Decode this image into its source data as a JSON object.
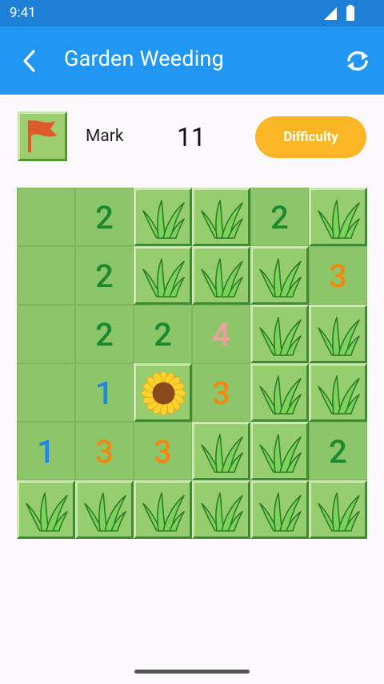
{
  "status_bar": {
    "time": "9:41",
    "icons": [
      "signal-icon",
      "battery-icon"
    ]
  },
  "app_bar": {
    "title": "Garden Weeding",
    "back_icon": "back-arrow-icon",
    "refresh_icon": "refresh-icon",
    "color": "#2196f3"
  },
  "toolbar": {
    "flag_icon": "flag-icon",
    "mode_label": "Mark",
    "mines_remaining": "11",
    "difficulty_label": "Difficulty",
    "difficulty_color": "#fbb626"
  },
  "board": {
    "rows": 6,
    "cols": 6,
    "cells": [
      [
        "r",
        "2",
        "g",
        "g",
        "2",
        "g"
      ],
      [
        "r",
        "2",
        "g",
        "g",
        "g",
        "3"
      ],
      [
        "r",
        "2",
        "2",
        "4",
        "g",
        "g"
      ],
      [
        "r",
        "1",
        "sun",
        "3",
        "g",
        "g"
      ],
      [
        "1",
        "3",
        "3",
        "g",
        "g",
        "2"
      ],
      [
        "g",
        "g",
        "g",
        "g",
        "g",
        "g"
      ]
    ]
  },
  "number_colors": {
    "1": "#1e88e5",
    "2": "#1b8a2f",
    "3": "#f5880f",
    "4": "#f49ca0"
  },
  "legend": {
    "r": "revealed-empty",
    "g": "grass-icon",
    "sun": "sunflower-icon"
  }
}
